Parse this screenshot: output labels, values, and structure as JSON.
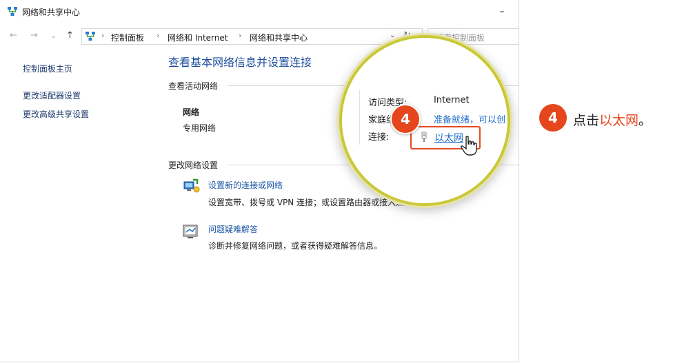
{
  "window": {
    "title": "网络和共享中心",
    "minimize": "–"
  },
  "nav": {
    "back": "←",
    "forward": "→",
    "recent": "⌄",
    "up": "↑",
    "breadcrumb": [
      "控制面板",
      "网络和 Internet",
      "网络和共享中心"
    ],
    "separator": "›",
    "dropdown": "⌄",
    "refresh": "↻",
    "search_placeholder": "搜索控制面板"
  },
  "sidebar": {
    "items": [
      "控制面板主页",
      "更改适配器设置",
      "更改高级共享设置"
    ]
  },
  "main": {
    "title": "查看基本网络信息并设置连接",
    "active_networks_heading": "查看活动网络",
    "network_name": "网络",
    "network_type": "专用网络",
    "change_settings_heading": "更改网络设置",
    "tasks": [
      {
        "link": "设置新的连接或网络",
        "desc": "设置宽带、拨号或 VPN 连接；或设置路由器或接入点。"
      },
      {
        "link": "问题疑难解答",
        "desc": "诊断并修复网络问题，或者获得疑难解答信息。"
      }
    ]
  },
  "magnifier": {
    "access_type_label": "访问类型:",
    "access_type_value": "Internet",
    "homegroup_label": "家庭组:",
    "homegroup_value": "准备就绪，可以创",
    "connection_label": "连接:",
    "connection_value": "以太网"
  },
  "annotation": {
    "step": "4",
    "prefix": "点击",
    "highlight": "以太网",
    "suffix": "。"
  },
  "colors": {
    "accent": "#e5461d",
    "link": "#1e5aa8",
    "magnifier_ring": "#c9c837"
  }
}
